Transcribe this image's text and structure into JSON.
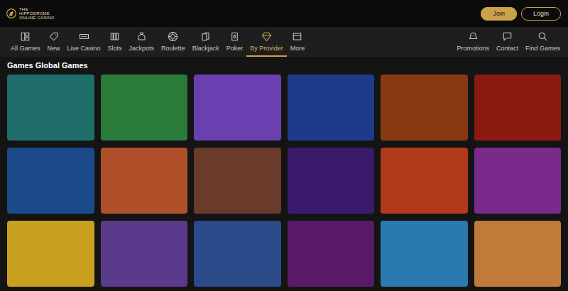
{
  "header": {
    "logo": [
      "THE",
      "HIPPODROME",
      "ONLINE CASINO"
    ],
    "buttons": [
      {
        "label": "Join",
        "kind": "primary"
      },
      {
        "label": "Login",
        "kind": "outline"
      }
    ]
  },
  "nav": {
    "items": [
      {
        "label": "All Games",
        "selected": false
      },
      {
        "label": "New",
        "selected": false
      },
      {
        "label": "Live Casino",
        "selected": false
      },
      {
        "label": "Slots",
        "selected": false
      },
      {
        "label": "Jackpots",
        "selected": false
      },
      {
        "label": "Roulette",
        "selected": false
      },
      {
        "label": "Blackjack",
        "selected": false
      },
      {
        "label": "Poker",
        "selected": false
      },
      {
        "label": "By Provider",
        "selected": true
      },
      {
        "label": "More",
        "selected": false
      }
    ],
    "right_items": [
      {
        "label": "Promotions"
      },
      {
        "label": "Contact"
      },
      {
        "label": "Find Games"
      }
    ]
  },
  "section": {
    "title": "Games Global Games",
    "games": [
      {
        "color": "#1f6e6a"
      },
      {
        "color": "#2a7a3a"
      },
      {
        "color": "#6a3fb0"
      },
      {
        "color": "#1e3a8a"
      },
      {
        "color": "#8a3a12"
      },
      {
        "color": "#8a1a12"
      },
      {
        "color": "#1a4a8a"
      },
      {
        "color": "#b0502a"
      },
      {
        "color": "#6a3a2a"
      },
      {
        "color": "#3a1a6a"
      },
      {
        "color": "#b03a1a"
      },
      {
        "color": "#7a2a8a"
      },
      {
        "color": "#c9a020"
      },
      {
        "color": "#5a3a8a"
      },
      {
        "color": "#2a4a8a"
      },
      {
        "color": "#5a1a6a"
      },
      {
        "color": "#2a7ab0"
      },
      {
        "color": "#c07a3a"
      }
    ]
  }
}
